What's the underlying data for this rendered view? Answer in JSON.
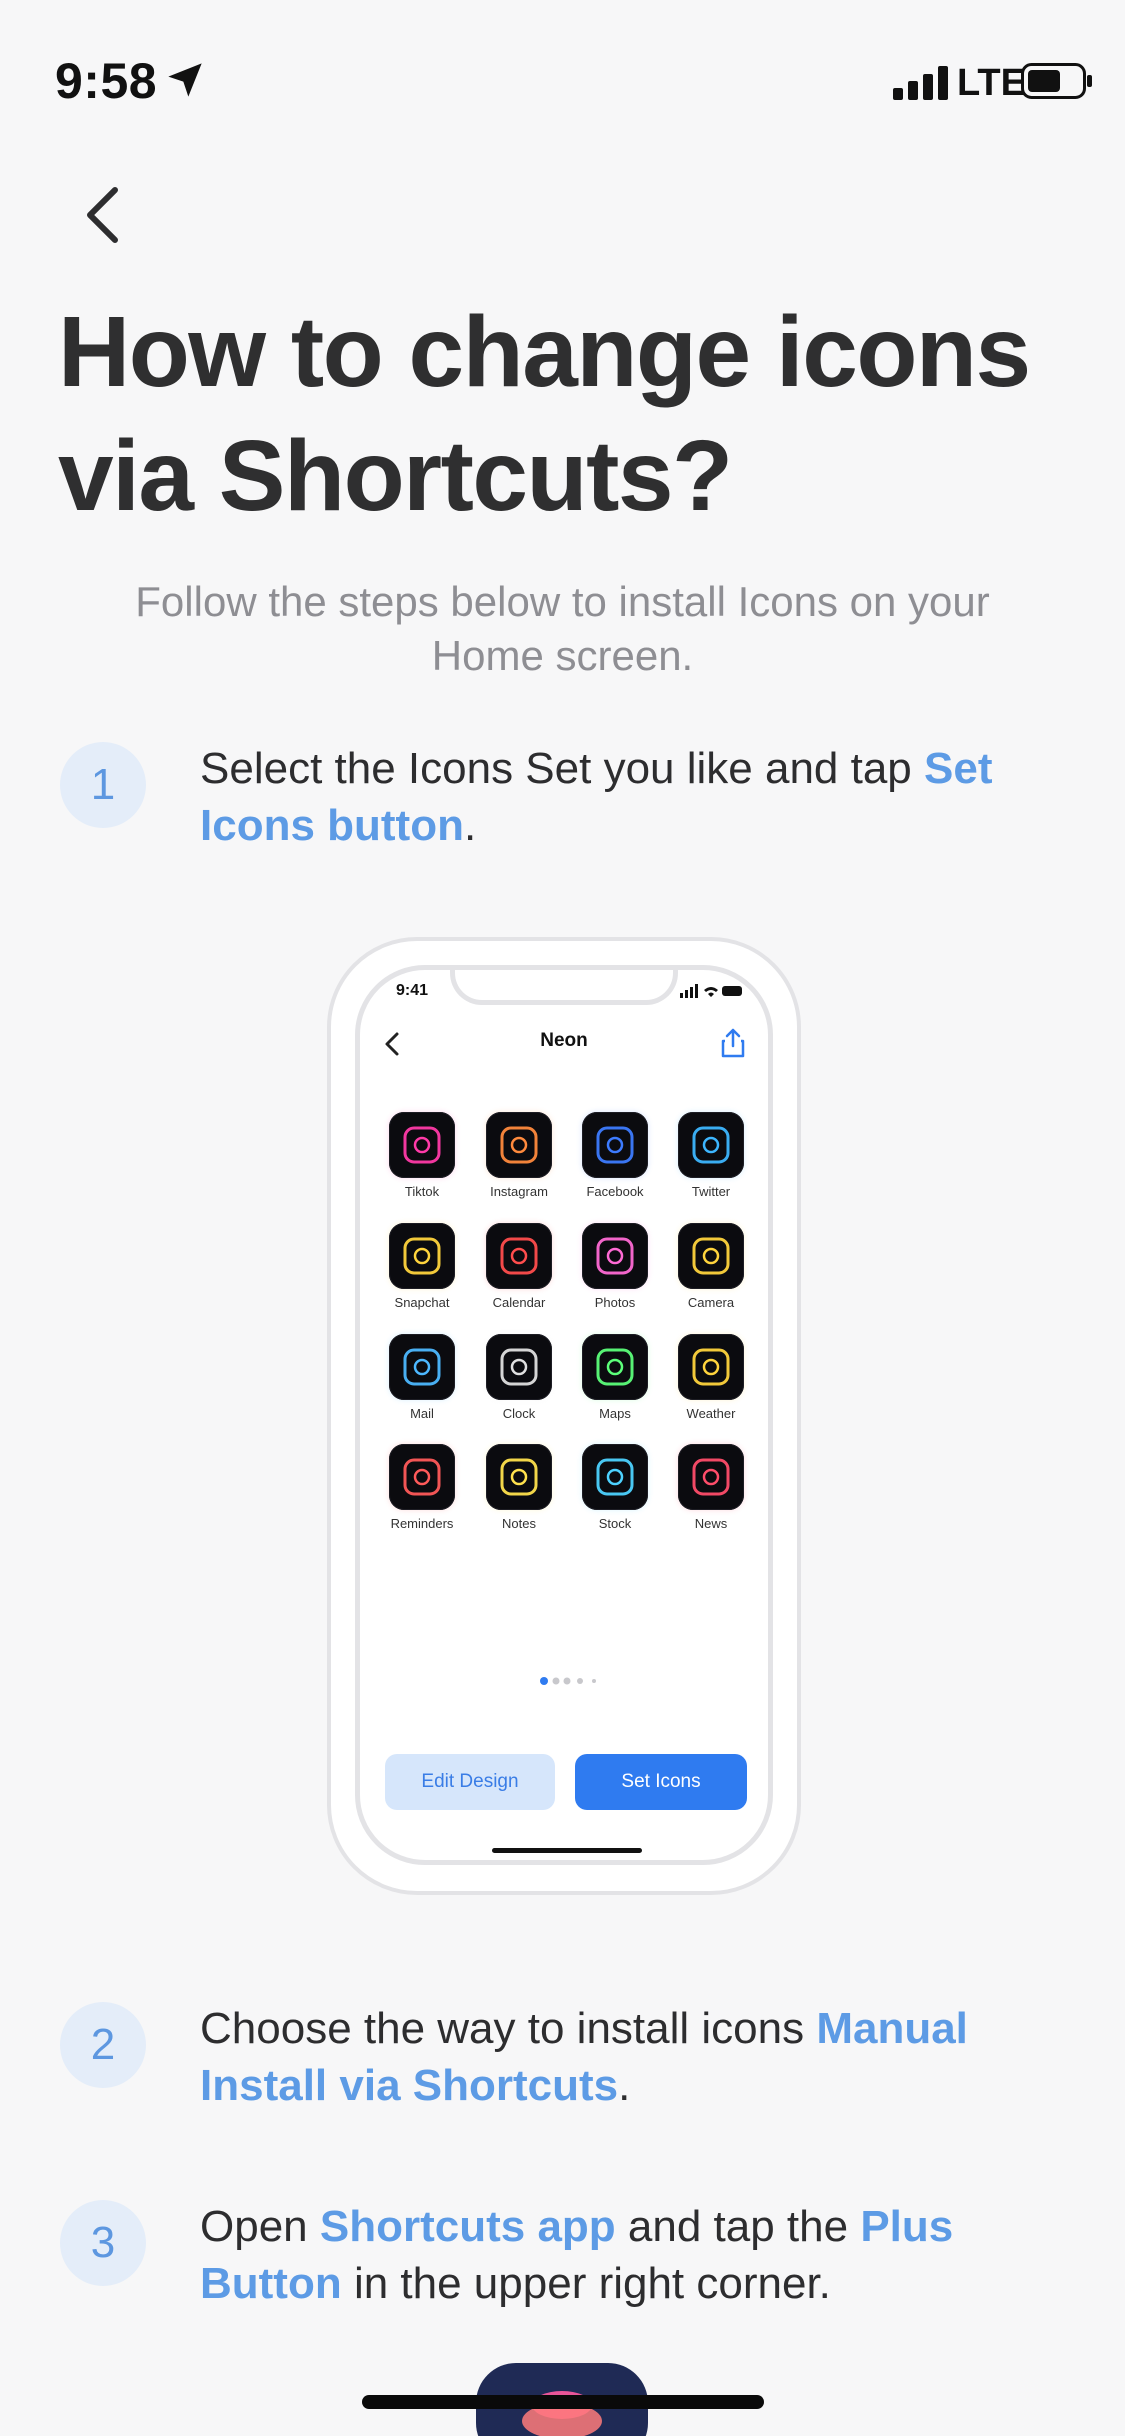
{
  "status_bar": {
    "time": "9:58",
    "network": "LTE"
  },
  "header": {
    "title": "How to change icons via Shortcuts?",
    "subtitle": "Follow the steps below to install Icons on your Home screen."
  },
  "steps": [
    {
      "number": "1",
      "text_before": "Select the Icons Set you like and tap ",
      "highlight": "Set Icons button",
      "text_after": "."
    },
    {
      "number": "2",
      "text_before": "Choose the way to install icons ",
      "highlight": "Manual Install via Shortcuts",
      "text_after": "."
    },
    {
      "number": "3",
      "text_before": "Open ",
      "highlight": "Shortcuts app",
      "text_middle": " and tap the ",
      "highlight2": "Plus Button",
      "text_after": " in the upper right corner."
    }
  ],
  "mockup": {
    "time": "9:41",
    "title": "Neon",
    "apps": [
      {
        "label": "Tiktok",
        "icon": "tiktok-icon",
        "color": "#ff3aa8"
      },
      {
        "label": "Instagram",
        "icon": "instagram-icon",
        "color": "#ff8a3d"
      },
      {
        "label": "Facebook",
        "icon": "facebook-icon",
        "color": "#3d7bff"
      },
      {
        "label": "Twitter",
        "icon": "twitter-icon",
        "color": "#3db6ff"
      },
      {
        "label": "Snapchat",
        "icon": "snapchat-icon",
        "color": "#ffd43d"
      },
      {
        "label": "Calendar",
        "icon": "calendar-icon",
        "color": "#ff4d4d"
      },
      {
        "label": "Photos",
        "icon": "photos-icon",
        "color": "#ff6ad5"
      },
      {
        "label": "Camera",
        "icon": "camera-icon",
        "color": "#ffd43d"
      },
      {
        "label": "Mail",
        "icon": "mail-icon",
        "color": "#4db8ff"
      },
      {
        "label": "Clock",
        "icon": "clock-icon",
        "color": "#e0e0e0"
      },
      {
        "label": "Maps",
        "icon": "maps-icon",
        "color": "#5cff7a"
      },
      {
        "label": "Weather",
        "icon": "weather-icon",
        "color": "#ffd43d"
      },
      {
        "label": "Reminders",
        "icon": "reminders-icon",
        "color": "#ff5a5a"
      },
      {
        "label": "Notes",
        "icon": "notes-icon",
        "color": "#ffe14d"
      },
      {
        "label": "Stock",
        "icon": "stock-icon",
        "color": "#4dd2ff"
      },
      {
        "label": "News",
        "icon": "news-icon",
        "color": "#ff4d6a"
      }
    ],
    "edit_button": "Edit Design",
    "set_button": "Set Icons"
  },
  "colors": {
    "accent": "#5d9be5",
    "button_primary": "#2f7bf0",
    "step_circle": "#e4edf9"
  }
}
